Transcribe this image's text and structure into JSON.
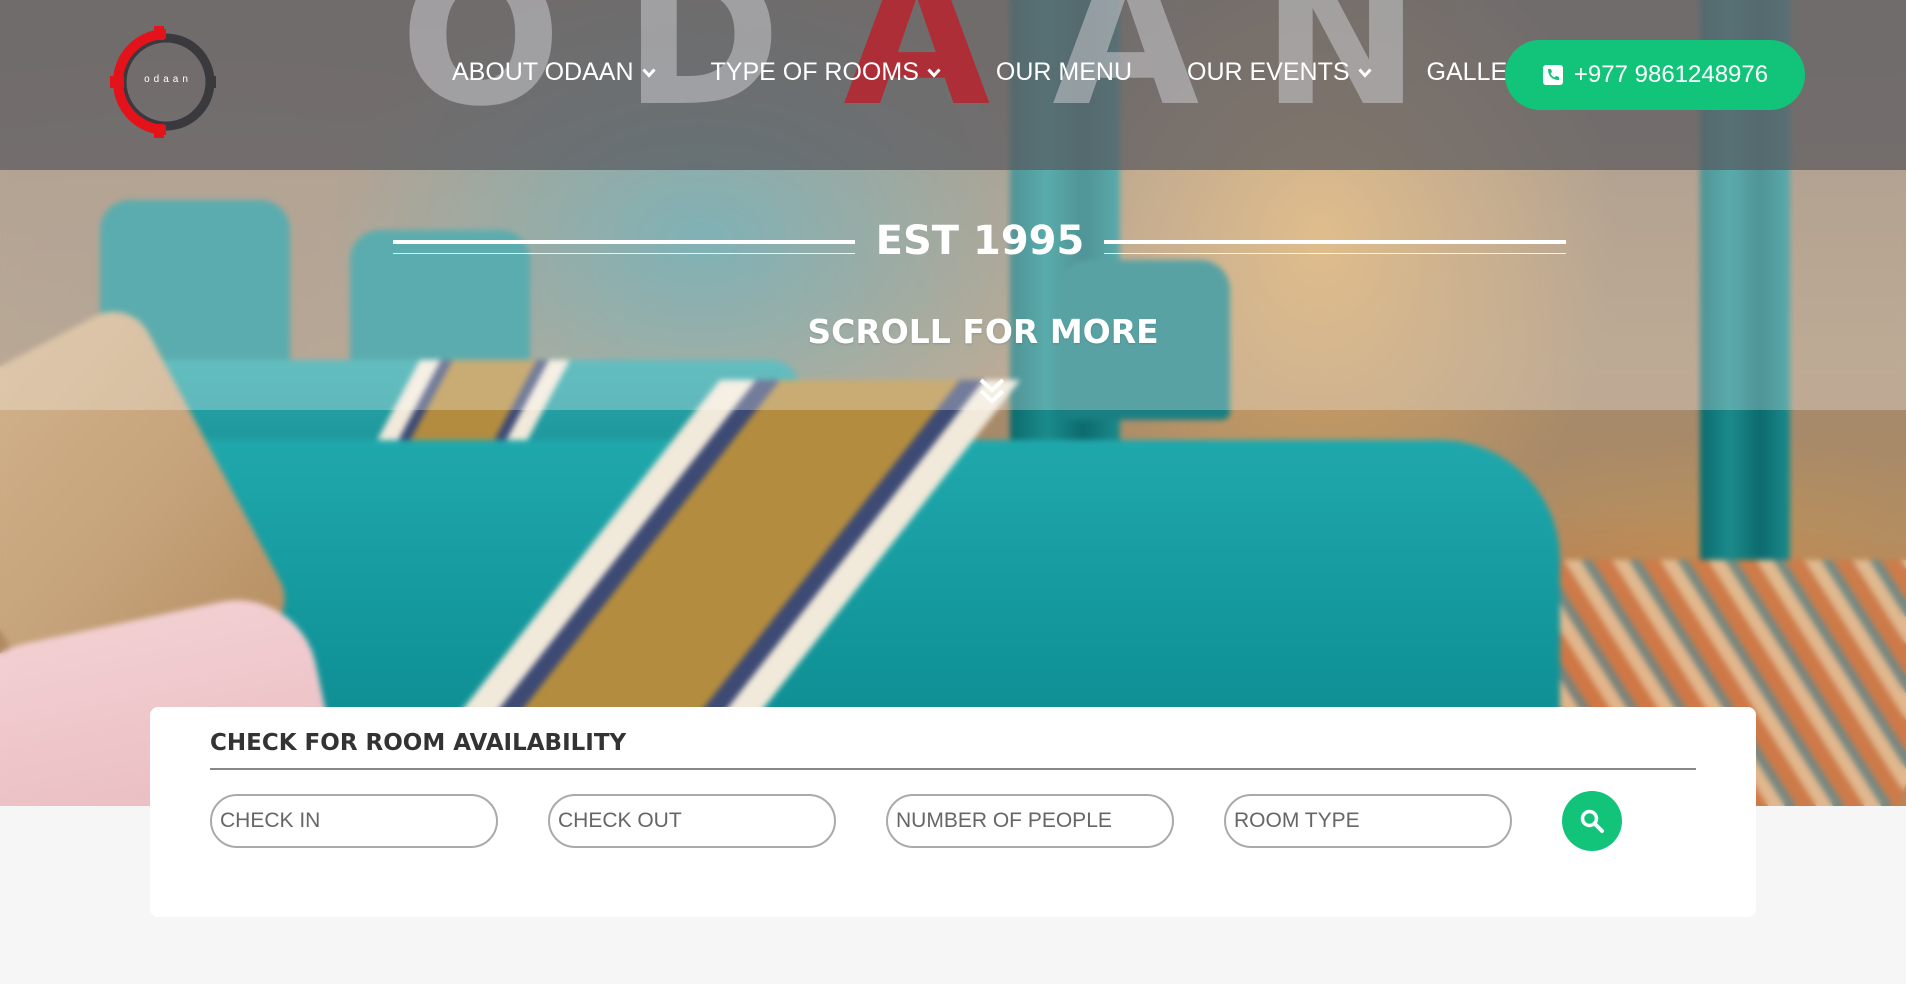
{
  "header": {
    "watermark_text": "ODAAN",
    "logo_text": "odaan",
    "nav": [
      {
        "label": "ABOUT ODAAN",
        "has_dropdown": true
      },
      {
        "label": "TYPE OF ROOMS",
        "has_dropdown": true
      },
      {
        "label": "OUR MENU",
        "has_dropdown": false
      },
      {
        "label": "OUR EVENTS",
        "has_dropdown": true
      },
      {
        "label": "GALLERY",
        "has_dropdown": false
      }
    ],
    "phone_label": "+977 9861248976",
    "icons": {
      "dropdown": "chevron-down-icon",
      "phone": "phone-icon"
    }
  },
  "hero": {
    "established": "EST 1995",
    "scroll_label": "SCROLL FOR MORE",
    "scroll_icon": "double-chevron-down-icon"
  },
  "booking": {
    "title": "CHECK FOR ROOM AVAILABILITY",
    "fields": [
      {
        "placeholder": "CHECK IN"
      },
      {
        "placeholder": "CHECK OUT"
      },
      {
        "placeholder": "NUMBER OF PEOPLE"
      },
      {
        "placeholder": "ROOM TYPE"
      }
    ],
    "search_icon": "search-icon"
  },
  "colors": {
    "accent_green": "#12c47a",
    "logo_red": "#e3121b",
    "watermark_red": "#b9232d",
    "header_overlay": "#69696e",
    "card_bg": "#ffffff",
    "text_dark": "#333333"
  }
}
